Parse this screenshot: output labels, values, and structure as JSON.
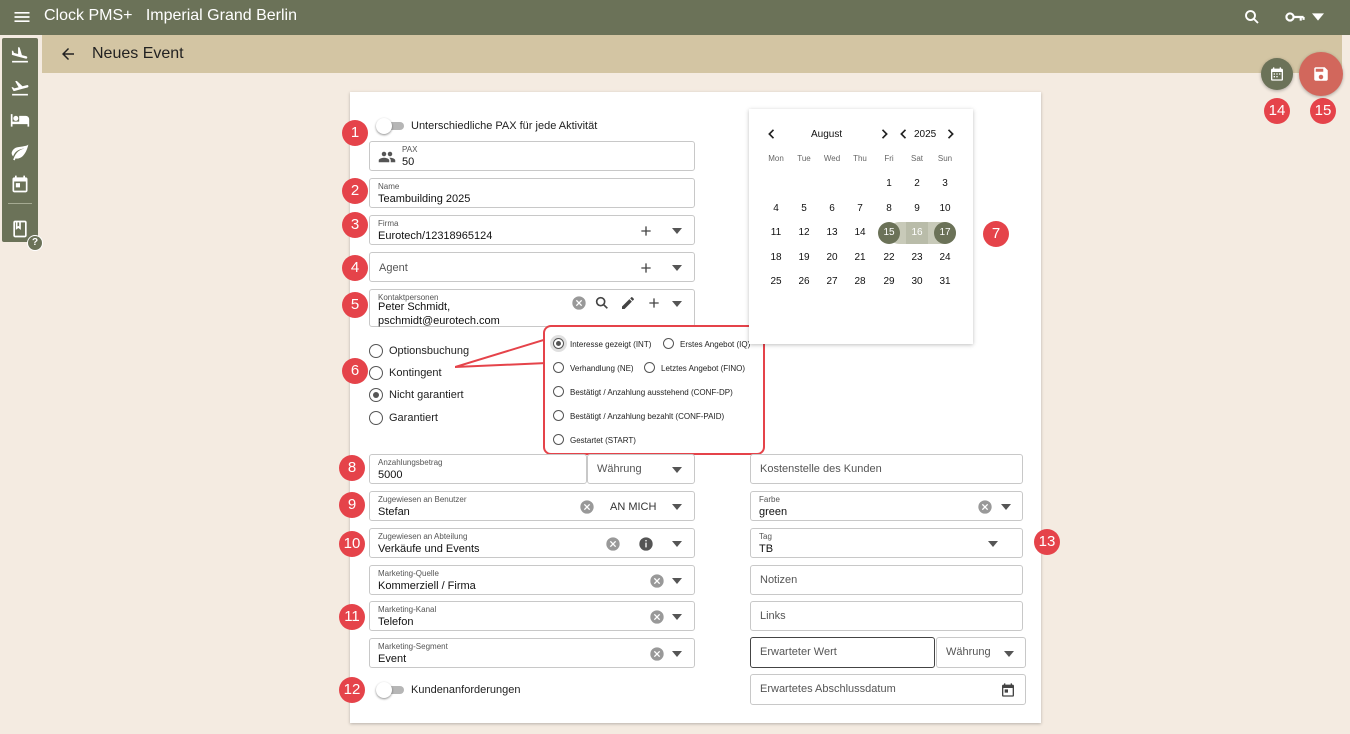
{
  "app": {
    "name": "Clock PMS+",
    "hotel": "Imperial Grand Berlin"
  },
  "page": {
    "title": "Neues Event"
  },
  "form": {
    "pax_toggle_label": "Unterschiedliche PAX für jede Aktivität",
    "pax": {
      "label": "PAX",
      "value": "50"
    },
    "name": {
      "label": "Name",
      "value": "Teambuilding 2025"
    },
    "firma": {
      "label": "Firma",
      "value": "Eurotech/12318965124"
    },
    "agent": {
      "placeholder": "Agent"
    },
    "kontakt": {
      "label": "Kontaktpersonen",
      "line1": "Peter Schmidt,",
      "line2": "pschmidt@eurotech.com"
    },
    "booking_types": [
      {
        "label": "Optionsbuchung",
        "selected": false
      },
      {
        "label": "Kontingent",
        "selected": false
      },
      {
        "label": "Nicht garantiert",
        "selected": true
      },
      {
        "label": "Garantiert",
        "selected": false
      }
    ],
    "anzahlung": {
      "label": "Anzahlungsbetrag",
      "value": "5000",
      "currency_placeholder": "Währung"
    },
    "benutzer": {
      "label": "Zugewiesen an Benutzer",
      "value": "Stefan",
      "action": "AN MICH"
    },
    "abteilung": {
      "label": "Zugewiesen an Abteilung",
      "value": "Verkäufe und Events"
    },
    "quelle": {
      "label": "Marketing-Quelle",
      "value": "Kommerziell / Firma"
    },
    "kanal": {
      "label": "Marketing-Kanal",
      "value": "Telefon"
    },
    "segment": {
      "label": "Marketing-Segment",
      "value": "Event"
    },
    "kunden_toggle_label": "Kundenanforderungen",
    "kostenstelle": {
      "placeholder": "Kostenstelle des Kunden"
    },
    "farbe": {
      "label": "Farbe",
      "value": "green"
    },
    "tag": {
      "label": "Tag",
      "value": "TB"
    },
    "notizen": {
      "placeholder": "Notizen"
    },
    "links": {
      "placeholder": "Links"
    },
    "erwarteter_wert": {
      "placeholder": "Erwarteter Wert",
      "currency_placeholder": "Währung"
    },
    "abschlussdatum": {
      "placeholder": "Erwartetes Abschlussdatum"
    }
  },
  "status_options": [
    {
      "label": "Interesse gezeigt (INT)",
      "selected": true
    },
    {
      "label": "Erstes Angebot (IQ)",
      "selected": false
    },
    {
      "label": "Verhandlung (NE)",
      "selected": false
    },
    {
      "label": "Letztes Angebot (FINO)",
      "selected": false
    },
    {
      "label": "Bestätigt / Anzahlung ausstehend (CONF-DP)",
      "selected": false
    },
    {
      "label": "Bestätigt / Anzahlung bezahlt (CONF-PAID)",
      "selected": false
    },
    {
      "label": "Gestartet (START)",
      "selected": false
    }
  ],
  "calendar": {
    "month": "August",
    "year": "2025",
    "weekdays": [
      "Mon",
      "Tue",
      "Wed",
      "Thu",
      "Fri",
      "Sat",
      "Sun"
    ],
    "weeks": [
      [
        "",
        "",
        "",
        "",
        "1",
        "2",
        "3"
      ],
      [
        "4",
        "5",
        "6",
        "7",
        "8",
        "9",
        "10"
      ],
      [
        "11",
        "12",
        "13",
        "14",
        "15",
        "16",
        "17"
      ],
      [
        "18",
        "19",
        "20",
        "21",
        "22",
        "23",
        "24"
      ],
      [
        "25",
        "26",
        "27",
        "28",
        "29",
        "30",
        "31"
      ]
    ],
    "range_start": "15",
    "range_mid": "16",
    "range_end": "17"
  },
  "annotations": [
    "1",
    "2",
    "3",
    "4",
    "5",
    "6",
    "7",
    "8",
    "9",
    "10",
    "11",
    "12",
    "13",
    "14",
    "15"
  ],
  "colors": {
    "header": "#6b7258",
    "subheader": "#d3c5a3",
    "background": "#f4ebe1",
    "badge": "#e5434a",
    "save_fab": "#d2675c",
    "calendar_fab": "#6b7258"
  }
}
